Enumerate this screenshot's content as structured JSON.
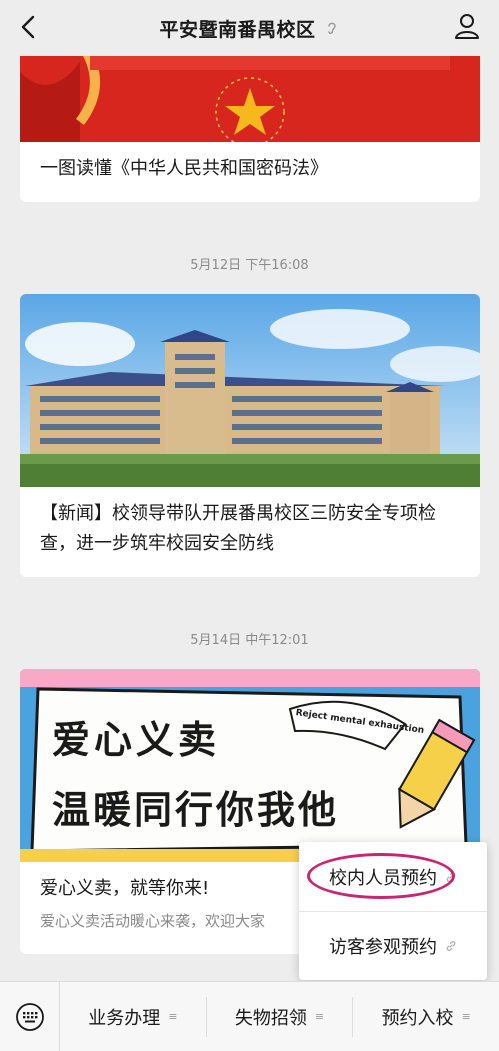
{
  "header": {
    "title": "平安暨南番禺校区"
  },
  "cards": [
    {
      "title": "一图读懂《中华人民共和国密码法》"
    },
    {
      "time": "5月12日 下午16:08",
      "title": "【新闻】校领导带队开展番禺校区三防安全专项检查，进一步筑牢校园安全防线"
    },
    {
      "time": "5月14日 中午12:01",
      "title": "爱心义卖，就等你来!",
      "subtitle": "爱心义卖活动暖心来袭，欢迎大家",
      "banner": {
        "line1": "爱心义卖",
        "line2": "温暖同行你我他",
        "sign": "Reject mental exhaustion"
      }
    }
  ],
  "popup": {
    "items": [
      {
        "label": "校内人员预约"
      },
      {
        "label": "访客参观预约"
      }
    ]
  },
  "bottom_menu": {
    "items": [
      {
        "label": "业务办理"
      },
      {
        "label": "失物招领"
      },
      {
        "label": "预约入校"
      }
    ]
  },
  "colors": {
    "accent_ring": "#c9266f",
    "banner_red": "#d6261d",
    "banner_blue": "#4aa3df"
  }
}
